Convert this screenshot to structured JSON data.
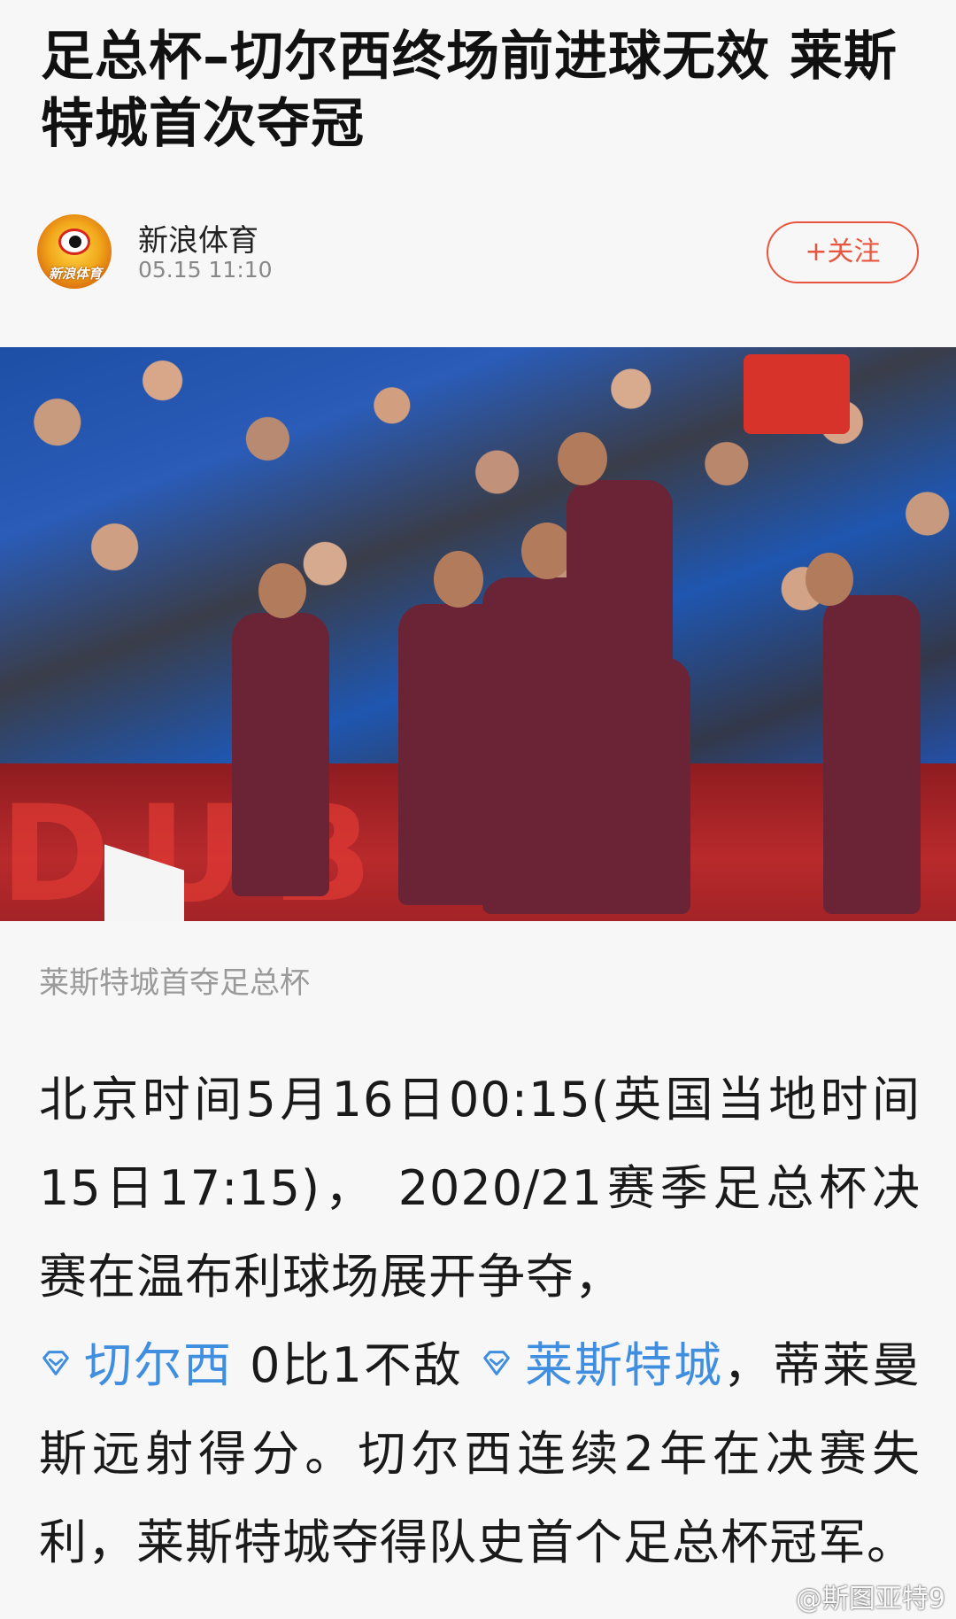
{
  "headline": "足总杯–切尔西终场前进球无效 莱斯特城首次夺冠",
  "author": {
    "name": "新浪体育",
    "time": "05.15  11:10",
    "avatar_label": "新浪体育",
    "follow_label": "+关注"
  },
  "photo": {
    "caption": "莱斯特城首夺足总杯",
    "board_text": "DUBAI"
  },
  "article": {
    "text_1": "北京时间5月16日00:15(英国当地时间15日17:15)， 2020/21赛季足总杯决赛在温布利球场展开争夺，",
    "tag_1": "切尔西",
    "text_2": " 0比1不敌",
    "tag_2": "莱斯特城",
    "text_3": "，蒂莱曼斯远射得分。切尔西连续2年在决赛失利，莱斯特城夺得队史首个足总杯冠军。"
  },
  "watermark": "@斯图亚特9",
  "colors": {
    "accent": "#e8553f",
    "tag": "#3f8ee0",
    "caption": "#9a9a9a"
  }
}
